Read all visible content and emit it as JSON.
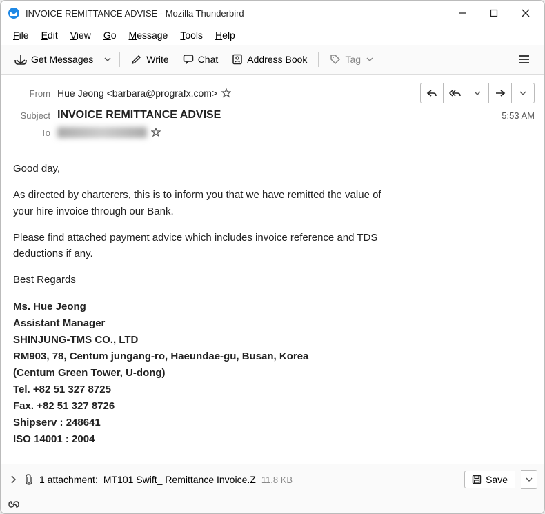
{
  "titlebar": {
    "title": "INVOICE REMITTANCE ADVISE - Mozilla Thunderbird"
  },
  "menubar": {
    "file": "File",
    "edit": "Edit",
    "view": "View",
    "go": "Go",
    "message": "Message",
    "tools": "Tools",
    "help": "Help"
  },
  "toolbar": {
    "get_messages": "Get Messages",
    "write": "Write",
    "chat": "Chat",
    "address_book": "Address Book",
    "tag": "Tag"
  },
  "headers": {
    "from_label": "From",
    "from_value": "Hue Jeong <barbara@prografx.com>",
    "subject_label": "Subject",
    "subject_value": "INVOICE REMITTANCE ADVISE",
    "to_label": "To",
    "time": "5:53 AM"
  },
  "body": {
    "greeting": "Good day,",
    "para1": "As directed by charterers, this is to inform you that we have remitted the value of your hire invoice through our Bank.",
    "para2": "Please find attached payment advice which includes invoice reference and TDS deductions if any.",
    "regards": "Best  Regards",
    "sig1": "Ms. Hue Jeong",
    "sig2": "Assistant Manager",
    "sig3": "SHINJUNG-TMS CO., LTD",
    "sig4": "RM903, 78, Centum jungang-ro, Haeundae-gu, Busan, Korea",
    "sig5": "(Centum Green Tower, U-dong)",
    "sig6": "Tel. +82 51 327 8725",
    "sig7": "Fax. +82 51 327 8726",
    "sig8": "Shipserv : 248641",
    "sig9": "ISO 14001 : 2004"
  },
  "attachments": {
    "count_text": "1 attachment:",
    "filename": "MT101 Swift_ Remittance Invoice.Z",
    "size": "11.8 KB",
    "save_label": "Save"
  }
}
